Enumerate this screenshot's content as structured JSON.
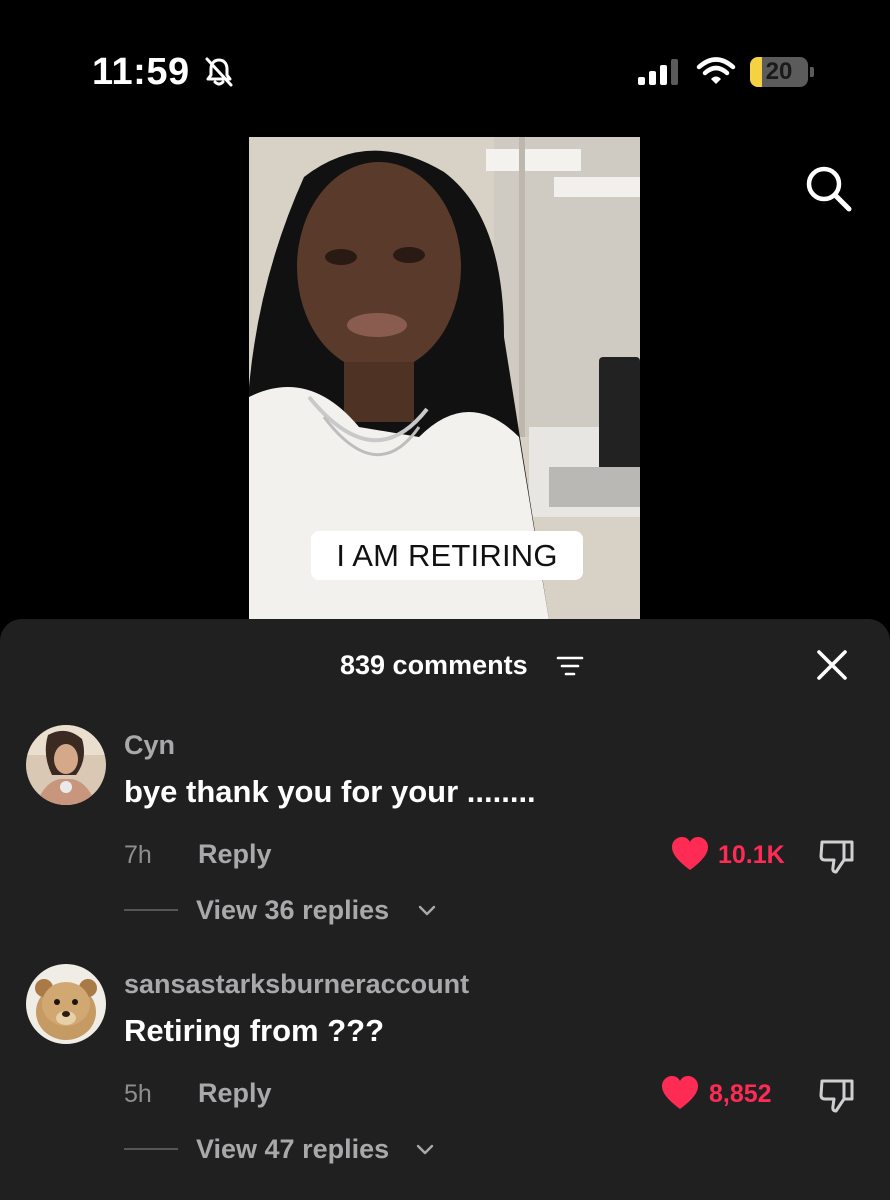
{
  "status_bar": {
    "time": "11:59",
    "battery_level": "20",
    "battery_fraction": 0.2,
    "icons": [
      "bell-slash-icon",
      "cellular-signal-icon",
      "wifi-icon",
      "battery-icon"
    ]
  },
  "top_bar": {
    "search_icon": "search-icon"
  },
  "video": {
    "caption": "I AM RETIRING"
  },
  "comments_panel": {
    "title": "839 comments",
    "filter_icon": "filter-icon",
    "close_icon": "close-icon",
    "comments": [
      {
        "username": "Cyn",
        "text": "bye thank you for your ........",
        "time": "7h",
        "reply_label": "Reply",
        "likes": "10.1K",
        "view_replies": "View 36 replies"
      },
      {
        "username": "sansastarksburneraccount",
        "text": "Retiring from ???",
        "time": "5h",
        "reply_label": "Reply",
        "likes": "8,852",
        "view_replies": "View 47 replies"
      }
    ]
  },
  "colors": {
    "background": "#000000",
    "sheet": "#202021",
    "like_red": "#fe2c55",
    "muted_text": "#a9a9ab",
    "battery_yellow": "#f4d242"
  }
}
